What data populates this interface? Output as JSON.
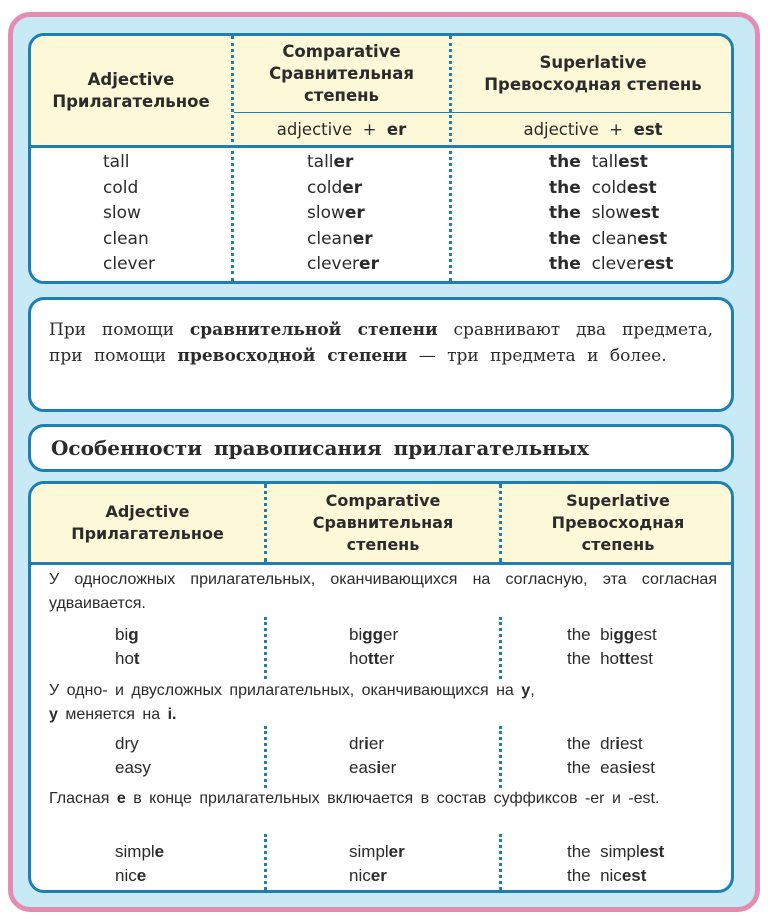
{
  "table1": {
    "headers": {
      "adjective": [
        "Adjective",
        "Прилагательное"
      ],
      "comparative": [
        "Comparative",
        "Сравнительная",
        "степень"
      ],
      "superlative": [
        "Superlative",
        "Превосходная степень"
      ]
    },
    "formulas": {
      "comparative": {
        "base": "adjective  +  ",
        "suffix": "er"
      },
      "superlative": {
        "base": "adjective  +  ",
        "suffix": "est"
      }
    },
    "rows": [
      {
        "adjective": "tall",
        "comp_stem": "tall",
        "comp_suffix": "er",
        "sup_article": "the",
        "sup_stem": "tall",
        "sup_suffix": "est"
      },
      {
        "adjective": "cold",
        "comp_stem": "cold",
        "comp_suffix": "er",
        "sup_article": "the",
        "sup_stem": "cold",
        "sup_suffix": "est"
      },
      {
        "adjective": "slow",
        "comp_stem": "slow",
        "comp_suffix": "er",
        "sup_article": "the",
        "sup_stem": "slow",
        "sup_suffix": "est"
      },
      {
        "adjective": "clean",
        "comp_stem": "clean",
        "comp_suffix": "er",
        "sup_article": "the",
        "sup_stem": "clean",
        "sup_suffix": "est"
      },
      {
        "adjective": "clever",
        "comp_stem": "clever",
        "comp_suffix": "er",
        "sup_article": "the",
        "sup_stem": "clever",
        "sup_suffix": "est"
      }
    ]
  },
  "note": {
    "parts": [
      "При помощи ",
      "сравнительной степени",
      " сравнивают два предмета, при помощи ",
      "превосходной степени",
      " — три предмета и более."
    ]
  },
  "heading": {
    "title": "Особенности правописания прилагательных"
  },
  "table2": {
    "headers": {
      "adjective": [
        "Adjective",
        "Прилагательное"
      ],
      "comparative": [
        "Comparative",
        "Сравнительная",
        "степень"
      ],
      "superlative": [
        "Superlative",
        "Превосходная",
        "степень"
      ]
    },
    "groups": [
      {
        "rule_parts": [
          "У односложных прилагательных, оканчивающихся на согласную, эта согласная удваивается."
        ],
        "rule_bold": [],
        "examples": [
          {
            "adj": [
              "bi",
              "g",
              ""
            ],
            "comp": [
              "bi",
              "gg",
              "er"
            ],
            "sup": [
              "the  bi",
              "gg",
              "est"
            ]
          },
          {
            "adj": [
              "ho",
              "t",
              ""
            ],
            "comp": [
              "ho",
              "tt",
              "er"
            ],
            "sup": [
              "the  ho",
              "tt",
              "est"
            ]
          }
        ]
      },
      {
        "rule_parts": [
          "У одно- и двусложных прилагательных, оканчивающихся на ",
          "y",
          ",",
          "y",
          " меняется на ",
          "i."
        ],
        "examples": [
          {
            "adj": [
              "dry",
              "",
              ""
            ],
            "comp": [
              "dr",
              "i",
              "er"
            ],
            "sup": [
              "the  dr",
              "i",
              "est"
            ]
          },
          {
            "adj": [
              "easy",
              "",
              ""
            ],
            "comp": [
              "eas",
              "i",
              "er"
            ],
            "sup": [
              "the  eas",
              "i",
              "est"
            ]
          }
        ]
      },
      {
        "rule_parts": [
          "Гласная ",
          "e",
          " в конце прилагательных включается в состав суффиксов -er и -est."
        ],
        "examples": [
          {
            "adj": [
              "simpl",
              "e",
              ""
            ],
            "comp": [
              "simpl",
              "er",
              ""
            ],
            "sup": [
              "the  simpl",
              "est",
              ""
            ]
          },
          {
            "adj": [
              "nic",
              "e",
              ""
            ],
            "comp": [
              "nic",
              "er",
              ""
            ],
            "sup": [
              "the  nic",
              "est",
              ""
            ]
          }
        ]
      }
    ]
  },
  "colors": {
    "frame_border": "#e58db1",
    "frame_bg": "#c8e9f6",
    "panel_border": "#1d7fb2",
    "header_bg": "#fdf8d7"
  }
}
